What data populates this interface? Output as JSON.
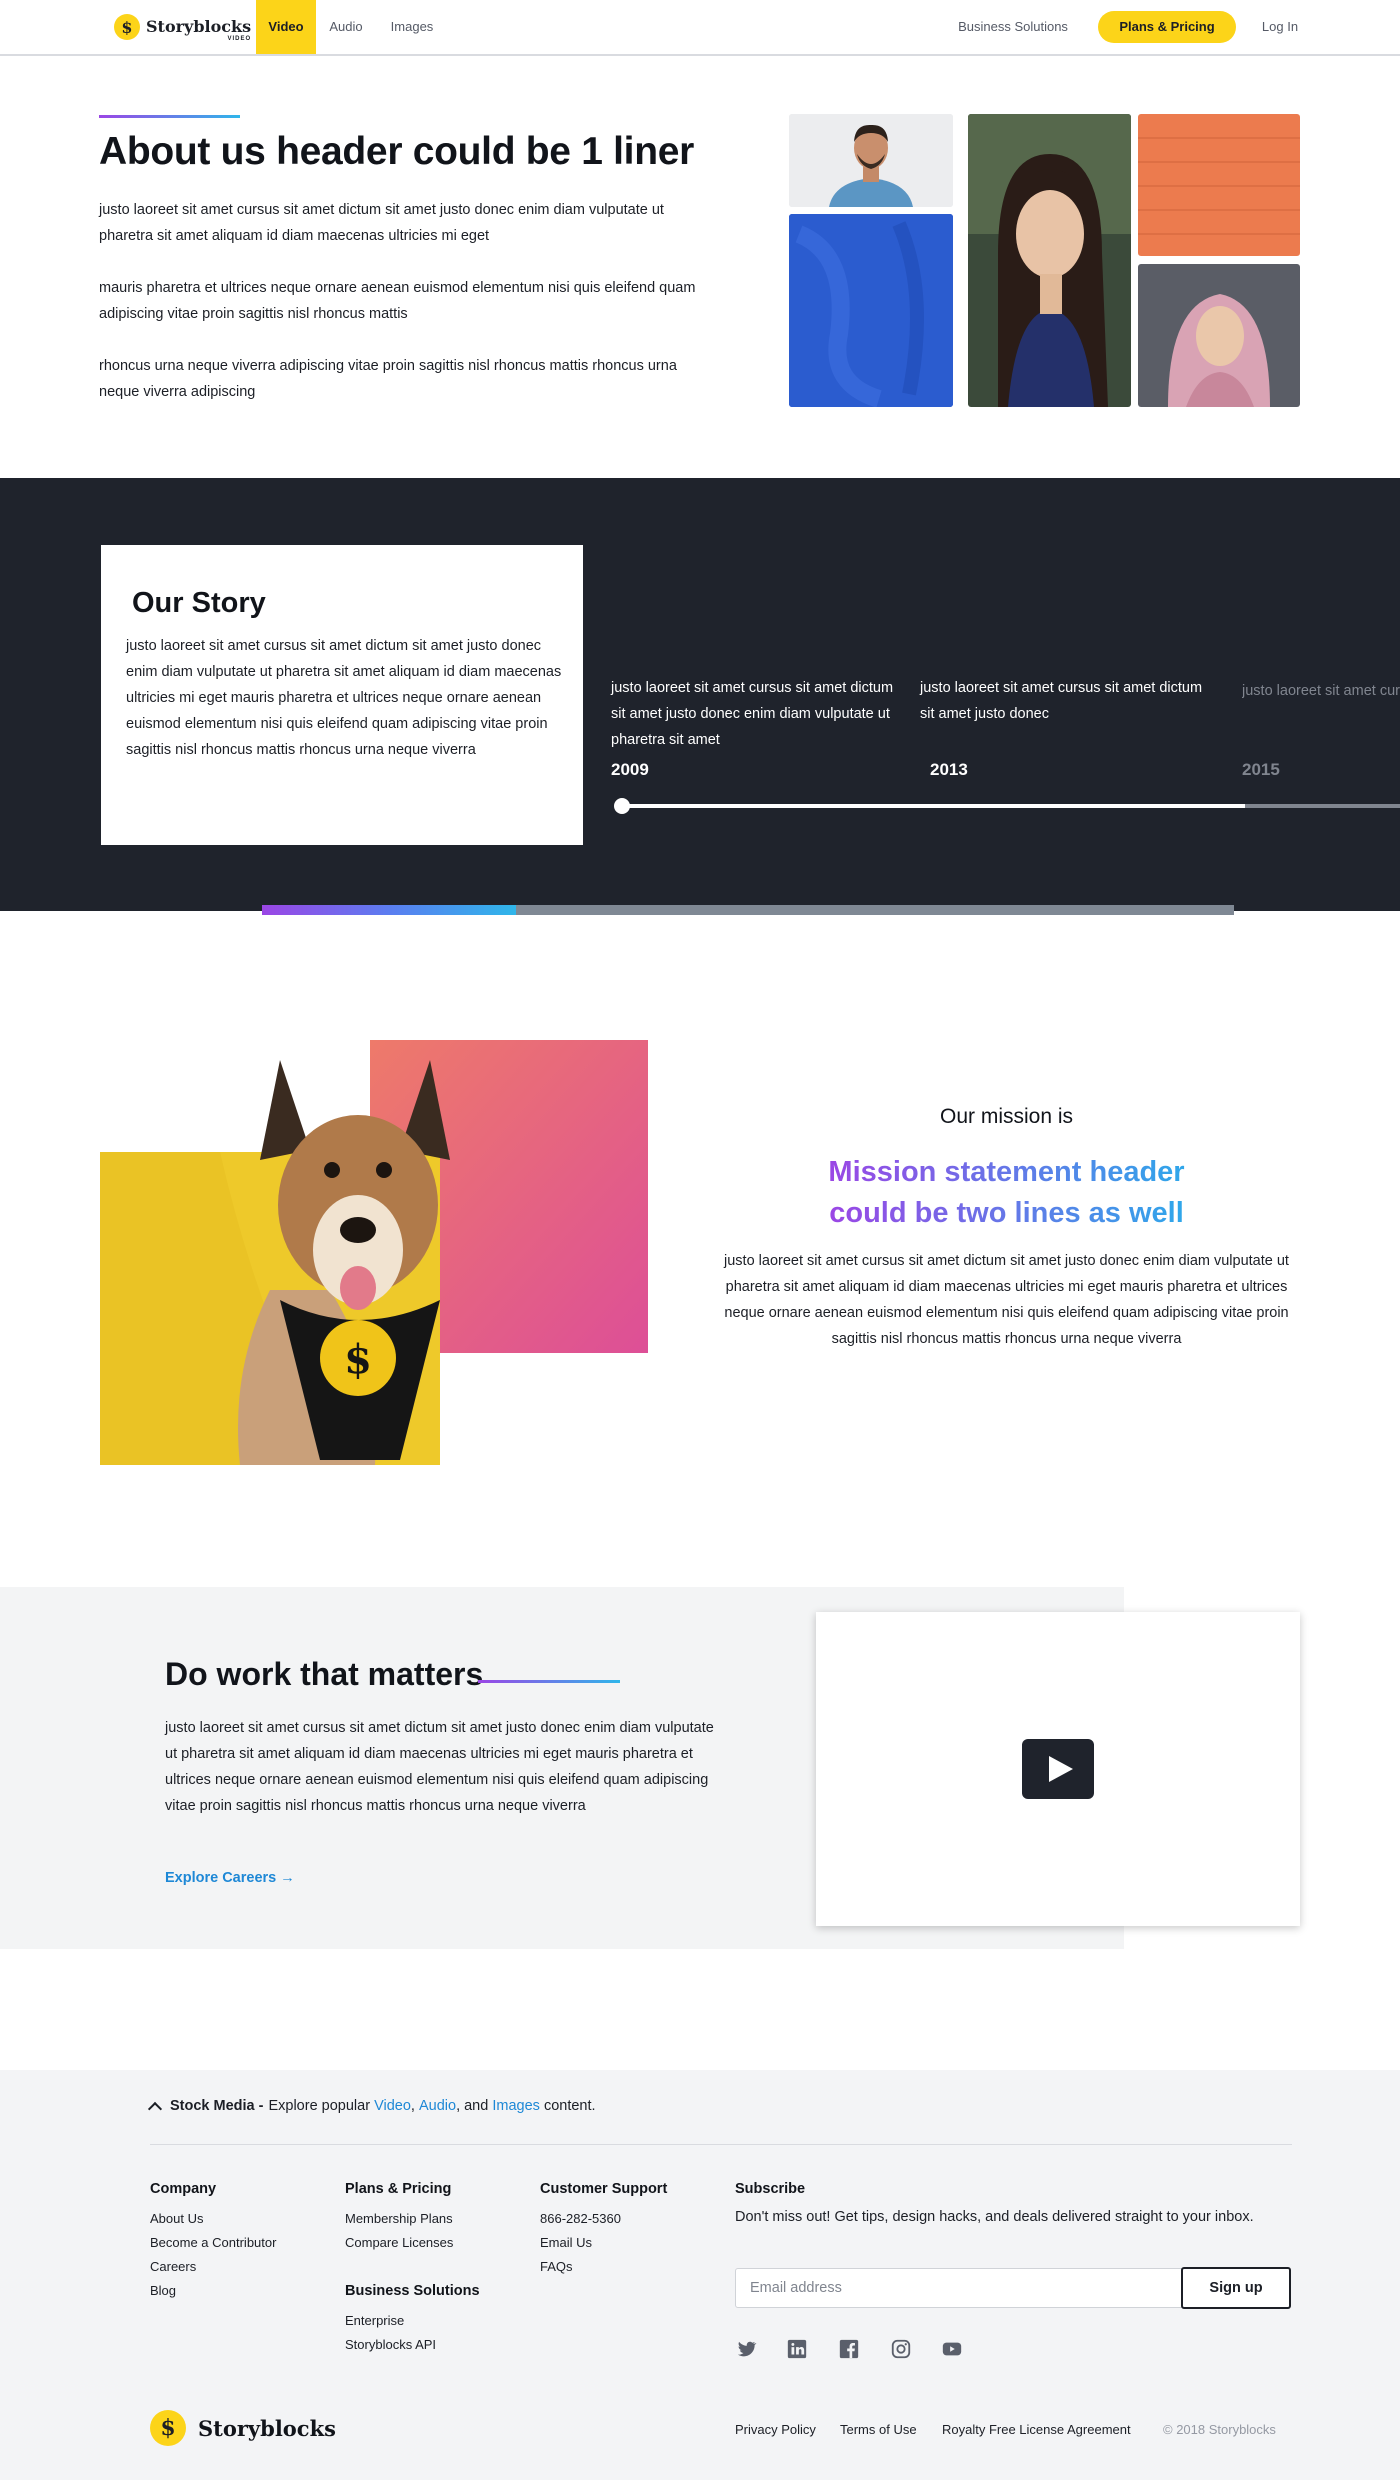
{
  "nav": {
    "brand": "Storyblocks",
    "brand_sub": "VIDEO",
    "items": [
      "Video",
      "Audio",
      "Images"
    ],
    "business": "Business Solutions",
    "plans": "Plans & Pricing",
    "login": "Log In"
  },
  "about": {
    "title": "About us header could be 1 liner",
    "paragraphs": [
      "justo laoreet sit amet cursus sit amet dictum sit amet justo donec enim diam vulputate ut pharetra sit amet aliquam id diam maecenas ultricies mi eget",
      "mauris pharetra et ultrices neque ornare aenean euismod elementum nisi quis eleifend quam adipiscing vitae proin sagittis nisl rhoncus mattis",
      "rhoncus urna neque viverra adipiscing vitae proin sagittis nisl rhoncus mattis rhoncus urna neque viverra adipiscing"
    ]
  },
  "story": {
    "title": "Our Story",
    "text": "justo laoreet sit amet cursus sit amet dictum sit amet justo donec enim diam vulputate ut pharetra sit amet aliquam id diam maecenas ultricies mi eget mauris pharetra et ultrices neque ornare aenean euismod elementum nisi quis eleifend quam adipiscing vitae proin sagittis nisl rhoncus mattis rhoncus urna neque viverra",
    "timeline": [
      {
        "text": "justo laoreet sit amet cursus sit amet dictum sit amet justo donec enim diam vulputate ut pharetra sit amet",
        "year": "2009"
      },
      {
        "text": "justo laoreet sit amet cursus sit amet dictum sit amet justo donec",
        "year": "2013"
      },
      {
        "text": "justo laoreet sit amet cursus sit amet dictum sit amet justo donec",
        "year": "2015"
      }
    ]
  },
  "mission": {
    "label": "Our mission is",
    "head_line1": "Mission statement header",
    "head_line2": "could be two lines as well",
    "text": "justo laoreet sit amet cursus sit amet dictum sit amet justo donec enim diam vulputate ut pharetra sit amet aliquam id diam maecenas ultricies mi eget mauris pharetra et ultrices neque ornare aenean euismod elementum nisi quis eleifend quam adipiscing vitae proin sagittis nisl rhoncus mattis rhoncus urna neque viverra"
  },
  "careers": {
    "title": "Do work that matters",
    "text": "justo laoreet sit amet cursus sit amet dictum sit amet justo donec enim diam vulputate ut pharetra sit amet aliquam id diam maecenas ultricies mi eget mauris pharetra et ultrices neque ornare aenean euismod elementum nisi quis eleifend quam adipiscing vitae proin sagittis nisl rhoncus mattis rhoncus urna neque viverra",
    "link": "Explore Careers →"
  },
  "footer": {
    "stock_label": "Stock Media -",
    "stock_pre": "Explore popular",
    "stock_video": "Video",
    "stock_audio": "Audio",
    "stock_and": ", and",
    "stock_images": "Images",
    "stock_post": "content.",
    "company": {
      "title": "Company",
      "items": [
        "About Us",
        "Become a Contributor",
        "Careers",
        "Blog"
      ]
    },
    "plans": {
      "title": "Plans & Pricing",
      "items": [
        "Membership Plans",
        "Compare Licenses"
      ]
    },
    "business": {
      "title": "Business Solutions",
      "items": [
        "Enterprise",
        "Storyblocks API"
      ]
    },
    "support": {
      "title": "Customer Support",
      "items": [
        "866-282-5360",
        "Email Us",
        "FAQs"
      ]
    },
    "subscribe": {
      "title": "Subscribe",
      "text": "Don't miss out! Get tips, design hacks, and deals delivered straight to your inbox.",
      "placeholder": "Email address",
      "button": "Sign up"
    },
    "social_icons": [
      "twitter-icon",
      "linkedin-icon",
      "facebook-icon",
      "instagram-icon",
      "youtube-icon"
    ],
    "brand": "Storyblocks",
    "legal": [
      "Privacy Policy",
      "Terms of Use",
      "Royalty Free License Agreement"
    ],
    "copyright": "© 2018 Storyblocks"
  },
  "colors": {
    "accent_yellow": "#fcd419",
    "dark": "#1f232c",
    "link_blue": "#1e88d6",
    "gradient_start": "#9b46e5",
    "gradient_end": "#2fb6ea"
  }
}
